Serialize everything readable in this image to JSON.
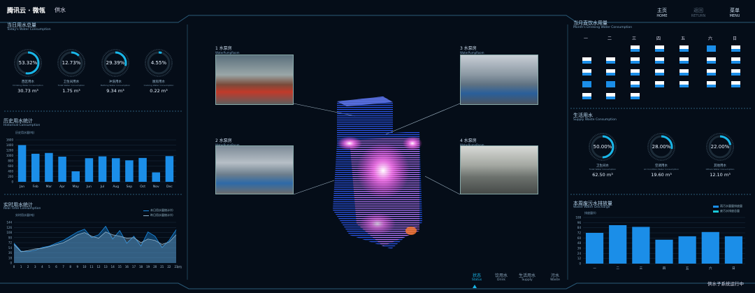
{
  "header": {
    "logo": "腾讯云 · 微瓴",
    "section": "供水",
    "nav": [
      {
        "zh": "主页",
        "en": "HOME"
      },
      {
        "zh": "返回",
        "en": "RETURN"
      },
      {
        "zh": "菜单",
        "en": "MENU"
      }
    ]
  },
  "today": {
    "title": "当日用水总量",
    "subtitle": "Today's Water Consumption",
    "rings": [
      {
        "pct": "53.32%",
        "frac": 0.5332,
        "zh": "西区用水",
        "en": "Drinking Water Consumption",
        "value": "30.73 m³"
      },
      {
        "pct": "12.73%",
        "frac": 0.1273,
        "zh": "卫生间用水",
        "en": "Toilet Water Consumption",
        "value": "1.75 m³"
      },
      {
        "pct": "29.39%",
        "frac": 0.2939,
        "zh": "冲洗用水",
        "en": "Bathing Water Consumption",
        "value": "9.34 m³"
      },
      {
        "pct": "4.55%",
        "frac": 0.0455,
        "zh": "厨房用水",
        "en": "Cooking Water Consumption",
        "value": "0.22 m³"
      }
    ]
  },
  "history_chart": {
    "title": "历史用水统计",
    "subtitle": "Historical Consumption",
    "unit": "历史用水量(吨)",
    "chart_data": {
      "type": "bar",
      "categories": [
        "Jan",
        "Feb",
        "Mar",
        "Apr",
        "May",
        "Jun",
        "Jul",
        "Aug",
        "Sep",
        "Oct",
        "Nov",
        "Dec"
      ],
      "values": [
        1400,
        1070,
        1100,
        960,
        400,
        900,
        970,
        900,
        820,
        910,
        360,
        980
      ],
      "yticks": [
        "1600",
        "1400",
        "1200",
        "1000",
        "800",
        "600",
        "400",
        "200",
        "0"
      ],
      "ylim": [
        0,
        1600
      ]
    }
  },
  "realtime_chart": {
    "title": "实时用水统计",
    "subtitle": "Real Time Consumption",
    "unit": "实时用水量(吨)",
    "legend": [
      "本日用水量统计(t)",
      "昨日用水量统计(t)"
    ],
    "xlabel_suffix": "(时)",
    "chart_data": {
      "type": "area",
      "x": [
        "0",
        "1",
        "2",
        "3",
        "4",
        "5",
        "6",
        "7",
        "8",
        "9",
        "10",
        "11",
        "12",
        "13",
        "14",
        "15",
        "16",
        "17",
        "18",
        "19",
        "20",
        "21",
        "22",
        "23"
      ],
      "series": [
        {
          "name": "本日用水量统计(t)",
          "values": [
            70,
            42,
            40,
            45,
            55,
            60,
            70,
            80,
            95,
            110,
            120,
            90,
            100,
            130,
            85,
            115,
            70,
            95,
            60,
            110,
            95,
            55,
            80,
            118
          ]
        },
        {
          "name": "昨日用水量统计(t)",
          "values": [
            66,
            40,
            44,
            50,
            52,
            58,
            65,
            72,
            85,
            100,
            108,
            95,
            88,
            110,
            100,
            95,
            88,
            90,
            72,
            85,
            80,
            66,
            74,
            100
          ]
        }
      ],
      "yticks": [
        "144",
        "126",
        "108",
        "90",
        "72",
        "54",
        "36",
        "18",
        "0"
      ],
      "ylim": [
        0,
        144
      ]
    }
  },
  "calendar": {
    "title": "当月直饮水用量",
    "subtitle": "Month's Drinking Water Consumption",
    "weekdays": [
      "一",
      "二",
      "三",
      "四",
      "五",
      "六",
      "日"
    ]
  },
  "supply": {
    "title": "生活用水",
    "subtitle": "Supply Waste Consumption",
    "rings": [
      {
        "pct": "50.00%",
        "frac": 0.5,
        "zh": "卫生间水",
        "en": "Toilet Water Consumption",
        "value": "62.50 m³"
      },
      {
        "pct": "28.00%",
        "frac": 0.28,
        "zh": "空调用水",
        "en": "Air Condition Water Consumption",
        "value": "19.60 m³"
      },
      {
        "pct": "22.00%",
        "frac": 0.22,
        "zh": "其他用水",
        "en": "Others Water Consumption",
        "value": "12.10 m³"
      }
    ]
  },
  "waste_chart": {
    "title": "本周废污水排放量",
    "subtitle": "Waste Water Discharge",
    "unit": "排放量(t)",
    "legend": [
      "雨污水量量排放量",
      "废污水排放总量"
    ],
    "chart_data": {
      "type": "bar",
      "categories": [
        "一",
        "二",
        "三",
        "四",
        "五",
        "六",
        "日"
      ],
      "values": [
        72,
        90,
        86,
        56,
        64,
        74,
        64
      ],
      "yticks": [
        "108",
        "96",
        "84",
        "72",
        "60",
        "48",
        "36",
        "24",
        "12",
        "0"
      ],
      "ylim": [
        0,
        108
      ]
    }
  },
  "pumps": [
    {
      "label": "1 水泵房",
      "en": "WaterPumpRoom"
    },
    {
      "label": "3 水泵房",
      "en": "WaterPumpRoom"
    },
    {
      "label": "2 水泵房",
      "en": "WaterPumpRoom"
    },
    {
      "label": "4 水泵房",
      "en": "WaterPumpRoom"
    }
  ],
  "bottom_nav": [
    {
      "zh": "状态",
      "en": "Status"
    },
    {
      "zh": "饮用水",
      "en": "Drink"
    },
    {
      "zh": "生活用水",
      "en": "Supply"
    },
    {
      "zh": "污水",
      "en": "Waste"
    }
  ],
  "status_text": "供水子系统运行中"
}
